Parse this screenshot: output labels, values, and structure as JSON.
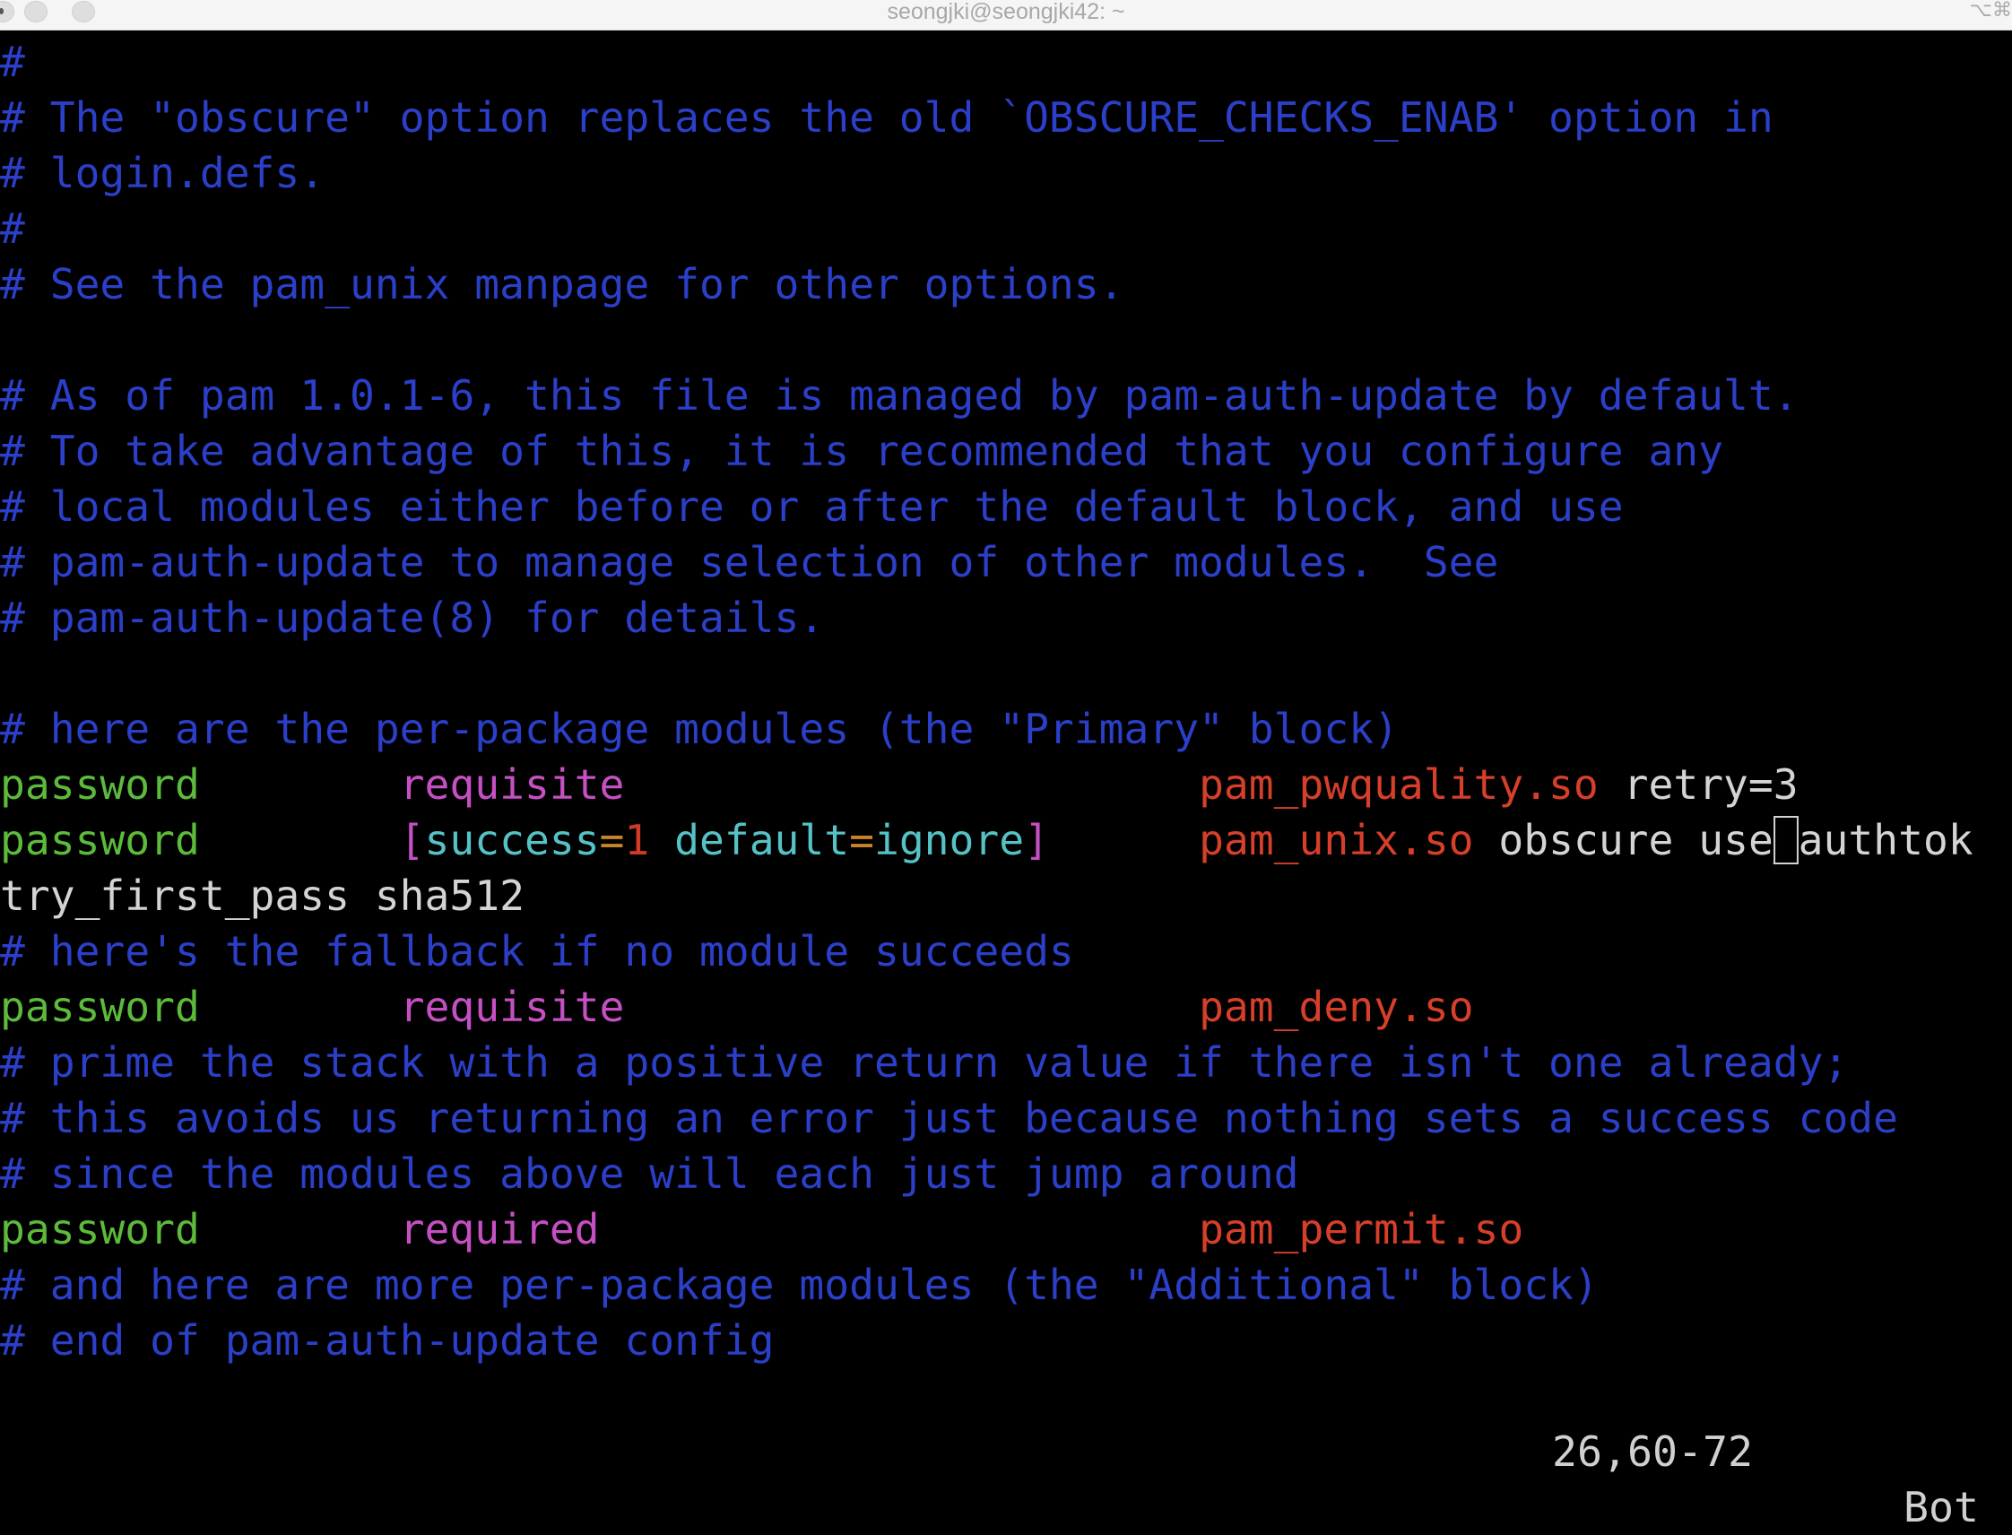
{
  "window": {
    "title": "seongjki@seongjki42: ~",
    "shortcut_hint": "⌥⌘",
    "buttons": [
      "close",
      "minimize",
      "zoom"
    ]
  },
  "editor": {
    "lines": [
      {
        "type": "comment",
        "text": "#"
      },
      {
        "type": "comment",
        "text": "# The \"obscure\" option replaces the old `OBSCURE_CHECKS_ENAB' option in"
      },
      {
        "type": "comment",
        "text": "# login.defs."
      },
      {
        "type": "comment",
        "text": "#"
      },
      {
        "type": "comment",
        "text": "# See the pam_unix manpage for other options."
      },
      {
        "type": "blank",
        "text": ""
      },
      {
        "type": "comment",
        "text": "# As of pam 1.0.1-6, this file is managed by pam-auth-update by default."
      },
      {
        "type": "comment",
        "text": "# To take advantage of this, it is recommended that you configure any"
      },
      {
        "type": "comment",
        "text": "# local modules either before or after the default block, and use"
      },
      {
        "type": "comment",
        "text": "# pam-auth-update to manage selection of other modules.  See"
      },
      {
        "type": "comment",
        "text": "# pam-auth-update(8) for details."
      },
      {
        "type": "blank",
        "text": ""
      },
      {
        "type": "comment",
        "text": "# here are the per-package modules (the \"Primary\" block)"
      },
      {
        "type": "rule",
        "module_type": "password",
        "control": "requisite",
        "module": "pam_pwquality.so",
        "args": "retry=3"
      },
      {
        "type": "rule_complex",
        "module_type": "password",
        "control_parts": [
          {
            "cls": "c-control",
            "text": "["
          },
          {
            "cls": "c-key",
            "text": "success"
          },
          {
            "cls": "c-eq",
            "text": "="
          },
          {
            "cls": "c-num",
            "text": "1"
          },
          {
            "cls": "c-key",
            "text": " default"
          },
          {
            "cls": "c-eq",
            "text": "="
          },
          {
            "cls": "c-key",
            "text": "ignore"
          },
          {
            "cls": "c-control",
            "text": "]"
          }
        ],
        "module": "pam_unix.so",
        "args_before_cursor": "obscure use",
        "cursor_char": "_",
        "args_after_cursor": "authtok"
      },
      {
        "type": "continuation",
        "text": "try_first_pass sha512"
      },
      {
        "type": "comment",
        "text": "# here's the fallback if no module succeeds"
      },
      {
        "type": "rule",
        "module_type": "password",
        "control": "requisite",
        "module": "pam_deny.so",
        "args": ""
      },
      {
        "type": "comment",
        "text": "# prime the stack with a positive return value if there isn't one already;"
      },
      {
        "type": "comment",
        "text": "# this avoids us returning an error just because nothing sets a success code"
      },
      {
        "type": "comment",
        "text": "# since the modules above will each just jump around"
      },
      {
        "type": "rule",
        "module_type": "password",
        "control": "required",
        "module": "pam_permit.so",
        "args": ""
      },
      {
        "type": "comment",
        "text": "# and here are more per-package modules (the \"Additional\" block)"
      },
      {
        "type": "comment",
        "text": "# end of pam-auth-update config"
      }
    ]
  },
  "statusline": {
    "position": "26,60-72",
    "scroll": "Bot"
  }
}
